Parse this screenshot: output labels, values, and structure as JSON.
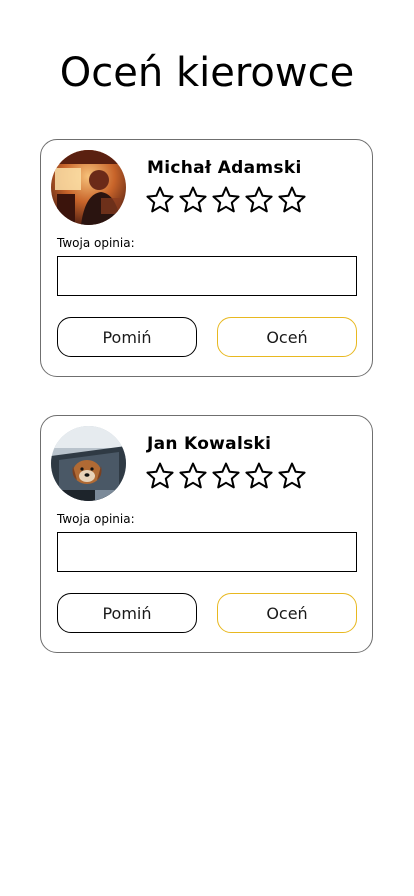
{
  "page": {
    "title": "Oceń kierowce"
  },
  "colors": {
    "card_border": "#6f6f6f",
    "rate_button_border": "#e8b820",
    "skip_button_border": "#000000"
  },
  "drivers": [
    {
      "name": "Michał Adamski",
      "avatar_icon": "driver-photo-warm-interior",
      "rating": 0,
      "max_rating": 5,
      "opinion_label": "Twoja opinia:",
      "opinion_value": "",
      "skip_label": "Pomiń",
      "rate_label": "Oceń"
    },
    {
      "name": "Jan Kowalski",
      "avatar_icon": "dog-in-car-window-photo",
      "rating": 0,
      "max_rating": 5,
      "opinion_label": "Twoja opinia:",
      "opinion_value": "",
      "skip_label": "Pomiń",
      "rate_label": "Oceń"
    }
  ]
}
